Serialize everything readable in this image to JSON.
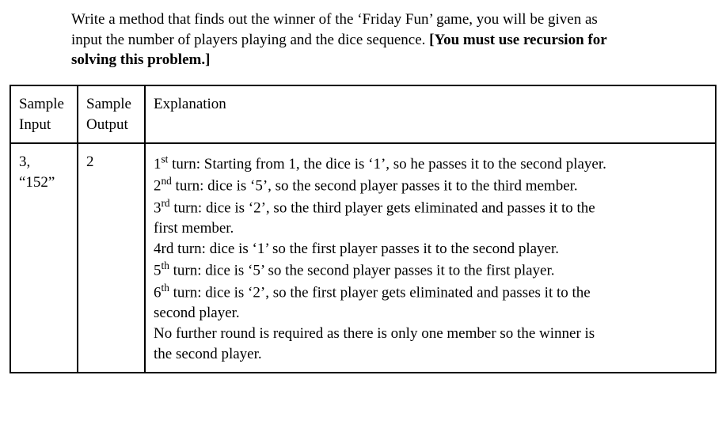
{
  "problem": {
    "line1": "Write a method that finds out the winner of the ‘Friday Fun’ game, you will be given as",
    "line2": "input the number of players playing and the dice sequence. ",
    "line2_bold": "[You must use recursion for",
    "line3_bold": "solving this problem.]"
  },
  "headers": {
    "input_l1": "Sample",
    "input_l2": "Input",
    "output_l1": "Sample",
    "output_l2": "Output",
    "explanation": "Explanation"
  },
  "sample": {
    "input_l1": "3,",
    "input_l2": "“152”",
    "output": "2",
    "expl": {
      "t1a": "1",
      "t1s": "st",
      "t1b": " turn: Starting from 1, the dice is ‘1’, so he passes it to the second player.",
      "t2a": "2",
      "t2s": "nd",
      "t2b": " turn:  dice is ‘5’, so the second player passes it to the third member.",
      "t3a": "3",
      "t3s": "rd",
      "t3b": " turn: dice is ‘2’, so the third player gets eliminated and passes it to the",
      "t3c": "first member.",
      "t4": "4rd turn: dice is ‘1’ so the first player passes it to the second player.",
      "t5a": "5",
      "t5s": "th",
      "t5b": " turn: dice is ‘5’ so the second player passes it to the first player.",
      "t6a": "6",
      "t6s": "th",
      "t6b": " turn: dice is ‘2’, so the first player gets eliminated and passes it to the",
      "t6c": "second player.",
      "t7": "No further round is required as there is only one member so the winner is",
      "t8": "the second player."
    }
  }
}
